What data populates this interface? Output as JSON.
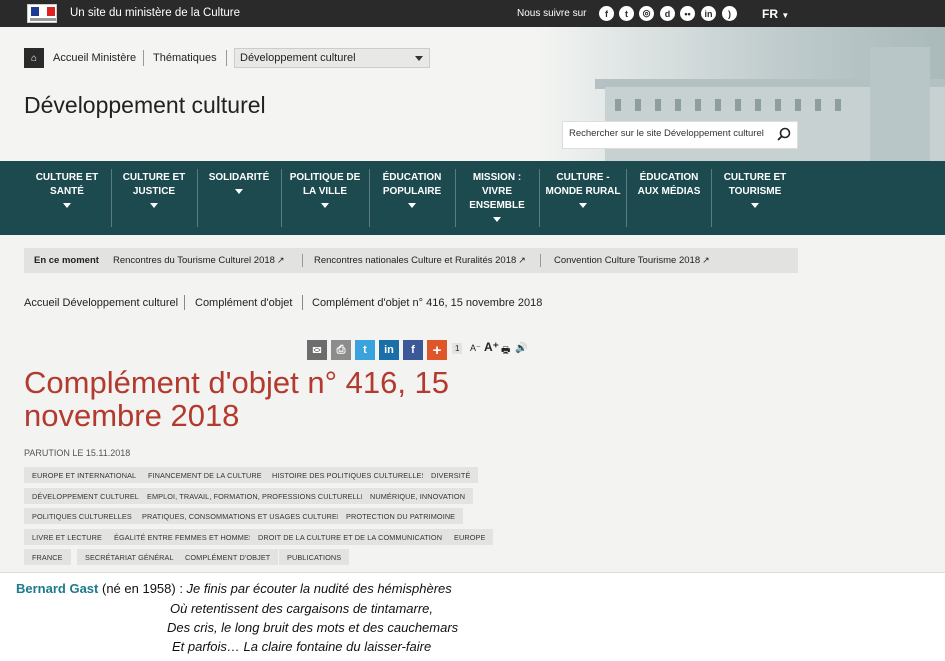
{
  "topbar": {
    "ministry": "Un site du ministère de la Culture",
    "follow": "Nous suivre sur",
    "social_icons": [
      "facebook-icon",
      "twitter-icon",
      "instagram-icon",
      "dailymotion-icon",
      "flickr-icon",
      "linkedin-icon",
      "rss-icon"
    ],
    "language": "FR"
  },
  "header": {
    "home_crumb": "Accueil Ministère",
    "themes_crumb": "Thématiques",
    "select_value": "Développement culturel",
    "site_title": "Développement culturel",
    "search_placeholder": "Rechercher sur le site Développement culturel"
  },
  "nav": [
    {
      "label": "CULTURE ET\nSANTÉ"
    },
    {
      "label": "CULTURE ET\nJUSTICE"
    },
    {
      "label": "SOLIDARITÉ"
    },
    {
      "label": "POLITIQUE DE\nLA VILLE"
    },
    {
      "label": "ÉDUCATION\nPOPULAIRE"
    },
    {
      "label": "MISSION :\nVIVRE\nENSEMBLE"
    },
    {
      "label": "CULTURE -\nMONDE RURAL"
    },
    {
      "label": "ÉDUCATION\nAUX MÉDIAS"
    },
    {
      "label": "CULTURE ET\nTOURISME"
    }
  ],
  "moment": {
    "label": "En ce moment",
    "links": [
      "Rencontres du Tourisme Culturel 2018",
      "Rencontres nationales Culture et Ruralités 2018",
      "Convention Culture Tourisme 2018"
    ]
  },
  "breadcrumb": [
    "Accueil Développement culturel",
    "Complément d'objet",
    "Complément d'objet n° 416, 15 novembre 2018"
  ],
  "share": {
    "count": "1",
    "font_small": "A⁻",
    "font_large": "A⁺",
    "colors": {
      "email": "#6d6d6d",
      "print": "#8c8c8c",
      "twitter": "#3aa3de",
      "linkedin": "#1b6fa8",
      "facebook": "#3b5998",
      "plus": "#e0562b"
    }
  },
  "article": {
    "title": "Complément d'objet n° 416, 15 novembre 2018",
    "parution": "PARUTION LE 15.11.2018",
    "tags": [
      [
        "EUROPE ET INTERNATIONAL",
        "FINANCEMENT DE LA CULTURE",
        "HISTOIRE DES POLITIQUES CULTURELLES",
        "DIVERSITÉ"
      ],
      [
        "DÉVELOPPEMENT CULTUREL",
        "EMPLOI, TRAVAIL, FORMATION, PROFESSIONS CULTURELLES",
        "NUMÉRIQUE, INNOVATION"
      ],
      [
        "POLITIQUES CULTURELLES",
        "PRATIQUES, CONSOMMATIONS ET USAGES CULTURELS",
        "PROTECTION DU PATRIMOINE"
      ],
      [
        "LIVRE ET LECTURE",
        "ÉGALITÉ ENTRE FEMMES ET HOMMES",
        "DROIT DE LA CULTURE ET DE LA COMMUNICATION",
        "EUROPE"
      ],
      [
        "FRANCE",
        "SECRÉTARIAT GÉNÉRAL",
        "COMPLÉMENT D'OBJET",
        "PUBLICATIONS"
      ]
    ]
  },
  "quote": {
    "author": "Bernard Gast",
    "born": " (né en 1958) : ",
    "lines": [
      "Je finis par écouter la nudité des hémisphères",
      "Où retentissent des cargaisons de tintamarre,",
      "Des cris, le long bruit des mots et des cauchemars",
      "Et parfois… La claire fontaine du laisser-faire"
    ]
  },
  "colors": {
    "nav_bg": "#1c4a4f",
    "title_red": "#b33a2e",
    "author_teal": "#1c7a8c"
  }
}
